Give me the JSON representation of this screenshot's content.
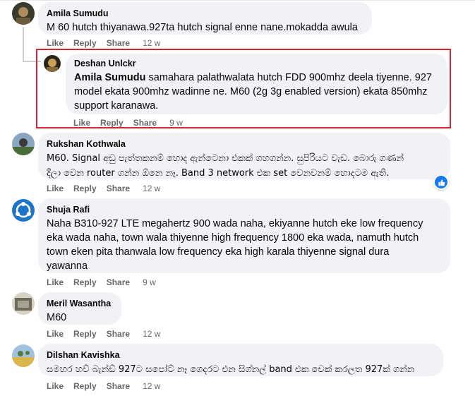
{
  "comments": [
    {
      "author": "Amila Sumudu",
      "text": "M 60 hutch thiyanawa.927ta hutch signal enne nane.mokadda awula",
      "like": "Like",
      "reply": "Reply",
      "share": "Share",
      "time": "12 w"
    },
    {
      "author": "Deshan Unlckr",
      "mention": "Amila Sumudu",
      "text_line1": "samahara palathwalata hutch FDD 900mhz deela tiyenne. 927",
      "text_line2": "model ekata 900mhz wadinne ne. M60 (2g 3g enabled version) ekata 850mhz",
      "text_line3": "support karanawa.",
      "like": "Like",
      "reply": "Reply",
      "share": "Share",
      "time": "9 w"
    },
    {
      "author": "Rukshan Kothwala",
      "text_line1": "M60. Signal අඩු පැත්තකනම් හොද ඇන්ටෙනා එකක් ගහගන්න. සුපිරියට වැඩ. බොරු ගණන්",
      "text_line2": "දීලා වෙන router ගන්න ඕනෙ නෑ. Band 3 network එක set වෙනවනම් හොදටම ඇති.",
      "like": "Like",
      "reply": "Reply",
      "share": "Share",
      "time": "12 w"
    },
    {
      "author": "Shuja Rafi",
      "text_line1": "Naha B310-927 LTE megahertz 900 wada naha, ekiyanne hutch eke low frequency",
      "text_line2": "eka wada naha, town wala thiyenne high frequency 1800 eka wada, namuth hutch",
      "text_line3": "town eken pita thanwala low frequency eka high karala thiyenne signal dura",
      "text_line4": "yawanna",
      "like": "Like",
      "reply": "Reply",
      "share": "Share",
      "time": "9 w"
    },
    {
      "author": "Meril Wasantha",
      "text": "M60",
      "like": "Like",
      "reply": "Reply",
      "share": "Share",
      "time": "12 w"
    },
    {
      "author": "Dilshan Kavishka",
      "text": "සමහර හව් බැන්ඩ් 927ට සපෝට් නෑ ගෙදරට එන සිග්නල් band එක චෙක් කරලත 927ක් ගන්න",
      "like": "Like",
      "reply": "Reply",
      "share": "Share",
      "time": "12 w"
    }
  ],
  "icons": {
    "like_reaction": "thumbs-up-icon"
  },
  "colors": {
    "accent": "#1877f2",
    "highlight": "#d9232e",
    "bubble": "#f0f2f5",
    "meta": "#65676b"
  }
}
